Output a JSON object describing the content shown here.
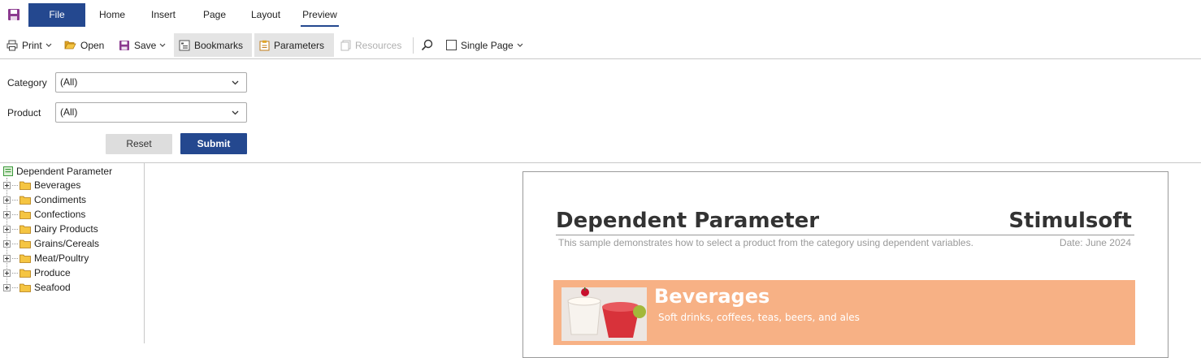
{
  "ribbon": {
    "file_label": "File",
    "tabs": [
      {
        "label": "Home"
      },
      {
        "label": "Insert"
      },
      {
        "label": "Page"
      },
      {
        "label": "Layout"
      },
      {
        "label": "Preview",
        "active": true
      }
    ]
  },
  "toolbar": {
    "print_label": "Print",
    "open_label": "Open",
    "save_label": "Save",
    "bookmarks_label": "Bookmarks",
    "parameters_label": "Parameters",
    "resources_label": "Resources",
    "single_page_label": "Single Page"
  },
  "parameters": {
    "category": {
      "label": "Category",
      "value": "(All)"
    },
    "product": {
      "label": "Product",
      "value": "(All)"
    },
    "reset_label": "Reset",
    "submit_label": "Submit"
  },
  "bookmarks": {
    "root_label": "Dependent Parameter",
    "items": [
      {
        "label": "Beverages"
      },
      {
        "label": "Condiments"
      },
      {
        "label": "Confections"
      },
      {
        "label": "Dairy Products"
      },
      {
        "label": "Grains/Cereals"
      },
      {
        "label": "Meat/Poultry"
      },
      {
        "label": "Produce"
      },
      {
        "label": "Seafood"
      }
    ]
  },
  "report": {
    "title": "Dependent Parameter",
    "brand": "Stimulsoft",
    "description": "This sample demonstrates how to select a product from the category using dependent variables.",
    "date": "Date: June 2024",
    "category": {
      "name": "Beverages",
      "description": "Soft drinks, coffees, teas, beers, and ales"
    }
  },
  "colors": {
    "accent": "#24488f",
    "band": "#f7b185",
    "folder": "#f5c542"
  }
}
